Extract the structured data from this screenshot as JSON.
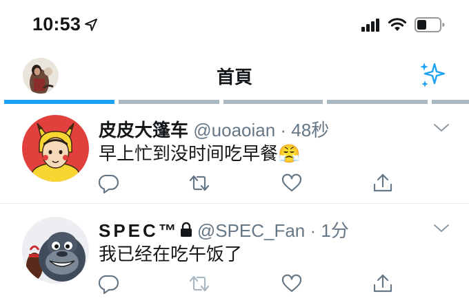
{
  "status_bar": {
    "time": "10:53"
  },
  "header": {
    "title": "首頁"
  },
  "icons": {
    "location": "location-arrow-icon",
    "signal": "cellular-signal-icon",
    "wifi": "wifi-icon",
    "battery": "battery-icon",
    "sparkle": "sparkle-icon",
    "reply": "reply-icon",
    "retweet": "retweet-icon",
    "like": "heart-icon",
    "share": "share-icon",
    "more": "chevron-down-icon",
    "lock": "lock-icon"
  },
  "colors": {
    "accent": "#1da1f2",
    "tab_inactive": "#aab8c2",
    "secondary_text": "#657786",
    "retweet_disabled": "#aab8c2"
  },
  "tweets": [
    {
      "display_name": "皮皮大篷车",
      "handle_meta": "@uoaoian · 48秒",
      "text": "早上忙到没时间吃早餐",
      "emoji": "😤"
    },
    {
      "display_name": "SPEC™",
      "handle_meta": "@SPEC_Fan · 1分",
      "text": "我已经在吃午饭了"
    }
  ]
}
